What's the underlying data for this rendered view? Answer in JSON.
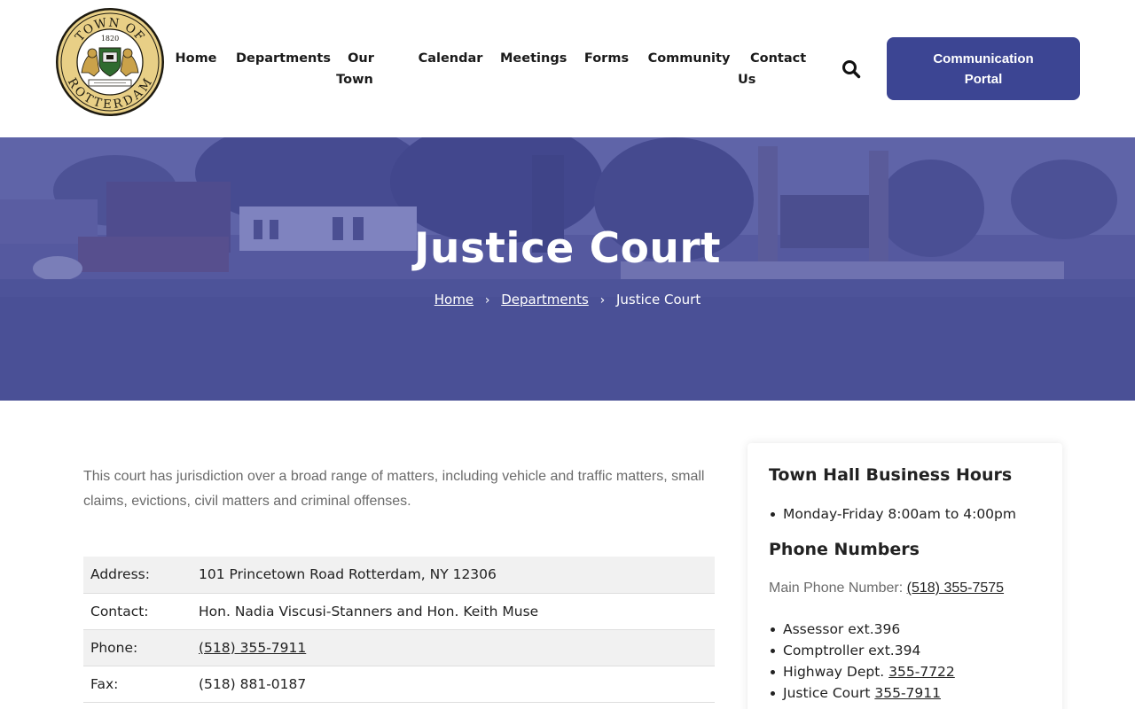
{
  "header": {
    "logo": {
      "top_text": "TOWN OF",
      "bottom_text": "ROTTERDAM",
      "year": "1820"
    },
    "nav": [
      {
        "label_line1": "Home",
        "label_line2": ""
      },
      {
        "label_line1": "Departments",
        "label_line2": ""
      },
      {
        "label_line1": "Our",
        "label_line2": "Town"
      },
      {
        "label_line1": "Calendar",
        "label_line2": ""
      },
      {
        "label_line1": "Meetings",
        "label_line2": ""
      },
      {
        "label_line1": "Forms",
        "label_line2": ""
      },
      {
        "label_line1": "Community",
        "label_line2": ""
      },
      {
        "label_line1": "Contact",
        "label_line2": "Us"
      }
    ],
    "search_icon": "search-icon",
    "portal_button": "Communication Portal"
  },
  "hero": {
    "title": "Justice Court",
    "breadcrumb": [
      {
        "label": "Home"
      },
      {
        "label": "Departments"
      },
      {
        "label": "Justice Court"
      }
    ]
  },
  "main": {
    "intro": "This court has jurisdiction over a broad range of matters, including vehicle and traffic matters, small claims, evictions, civil matters and criminal offenses.",
    "rows": [
      {
        "label": "Address:",
        "value": "101 Princetown Road Rotterdam, NY 12306"
      },
      {
        "label": "Contact:",
        "value": "Hon. Nadia Viscusi-Stanners and Hon. Keith Muse"
      },
      {
        "label": "Phone:",
        "value": "(518) 355-7911"
      },
      {
        "label": "Fax:",
        "value": "(518) 881-0187"
      }
    ]
  },
  "sidebar": {
    "hours_heading": "Town Hall Business Hours",
    "hours": "Monday-Friday 8:00am to 4:00pm",
    "phone_heading": "Phone Numbers",
    "main_phone_label": "Main Phone Number:",
    "main_phone": "(518) 355-7575",
    "extensions": [
      {
        "name": "Assessor ext.396",
        "link": ""
      },
      {
        "name": "Comptroller ext.394",
        "link": ""
      },
      {
        "name": "Highway Dept.",
        "link": "355-7722"
      },
      {
        "name": "Justice Court",
        "link": "355-7911"
      }
    ]
  },
  "colors": {
    "brand": "#3c4593",
    "hero_overlay": "#4a509c",
    "intro_text": "#6b6b6b"
  }
}
